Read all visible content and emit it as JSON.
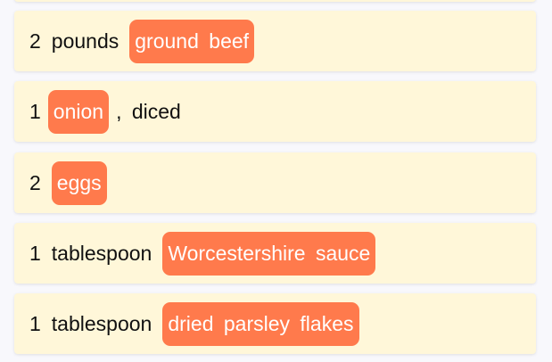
{
  "ingredients": [
    {
      "amount": "2",
      "unit": "pounds",
      "tag": "ground beef",
      "suffix": ""
    },
    {
      "amount": "1",
      "unit": "",
      "tag": "onion",
      "suffix": ", diced"
    },
    {
      "amount": "2",
      "unit": "",
      "tag": "eggs",
      "suffix": ""
    },
    {
      "amount": "1",
      "unit": "tablespoon",
      "tag": "Worcestershire sauce",
      "suffix": ""
    },
    {
      "amount": "1",
      "unit": "tablespoon",
      "tag": "dried parsley flakes",
      "suffix": ""
    }
  ],
  "colors": {
    "card_background": "#fff7d9",
    "tag_background": "#ff7a4c",
    "tag_text": "#ffffff",
    "page_background": "#f8f8fc"
  }
}
